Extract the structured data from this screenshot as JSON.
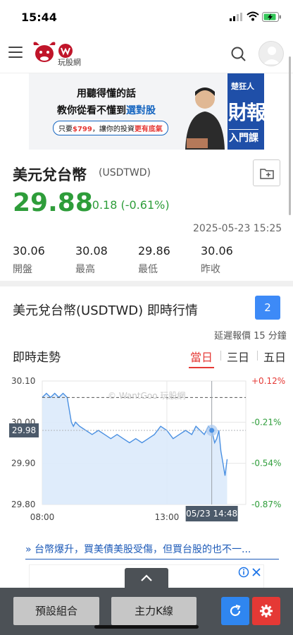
{
  "status": {
    "time": "15:44"
  },
  "nav": {
    "logo_text": "玩股網"
  },
  "banner": {
    "line1": "用聽得懂的話",
    "line2_pre": "教你從看不懂到",
    "line2_em": "選對股",
    "line3_pre": "只要",
    "line3_price": "$799",
    "line3_mid": "，讓你的投資",
    "line3_em": "更有底氣",
    "brand_name": "楚狂人",
    "brand_big": "財報",
    "brand_sub": "入門課"
  },
  "quote": {
    "name": "美元兌台幣",
    "code": "(USDTWD)",
    "price": "29.88",
    "change": "-0.18 (-0.61%)",
    "timestamp": "2025-05-23 15:25",
    "stats": [
      {
        "value": "30.06",
        "label": "開盤"
      },
      {
        "value": "30.08",
        "label": "最高"
      },
      {
        "value": "29.86",
        "label": "最低"
      },
      {
        "value": "30.06",
        "label": "昨收"
      }
    ]
  },
  "realtime": {
    "title": "美元兌台幣(USDTWD) 即時行情",
    "badge": "2",
    "delay_note": "延遲報價 15 分鐘",
    "trend_label": "即時走勢",
    "tabs": [
      "當日",
      "三日",
      "五日"
    ],
    "active_tab": "當日"
  },
  "chart_data": {
    "type": "line",
    "watermark": "© WantGoo 玩股網",
    "y_ticks": [
      "30.10",
      "30.00",
      "29.90",
      "29.80"
    ],
    "ylim": [
      29.8,
      30.1
    ],
    "right_ticks": [
      "+0.12%",
      "-0.21%",
      "-0.54%",
      "-0.87%"
    ],
    "x_ticks": [
      "08:00",
      "13:00"
    ],
    "reference_value": 30.06,
    "current_value_label": "29.98",
    "crosshair_time_label": "05/23 14:48",
    "colors": {
      "line": "#4a90e2",
      "fill": "#dceafb",
      "ref": "#555555",
      "up": "#e53935",
      "down": "#2e9d3a"
    },
    "series": [
      {
        "x": [
          "08:00",
          "08:10",
          "08:20",
          "08:30",
          "08:40",
          "08:50",
          "09:00",
          "09:10",
          "09:15",
          "09:20",
          "09:30",
          "09:45",
          "10:00",
          "10:15",
          "10:30",
          "10:45",
          "11:00",
          "11:15",
          "11:30",
          "11:45",
          "12:00",
          "12:15",
          "12:30",
          "12:45",
          "13:00",
          "13:15",
          "13:30",
          "13:45",
          "14:00",
          "14:10",
          "14:20",
          "14:30",
          "14:40",
          "14:48",
          "14:55",
          "15:00",
          "15:05",
          "15:10",
          "15:15",
          "15:20",
          "15:25"
        ],
        "values": [
          30.06,
          30.07,
          30.06,
          30.07,
          30.06,
          30.07,
          30.06,
          30.0,
          29.99,
          30.0,
          29.99,
          29.98,
          29.97,
          29.98,
          29.97,
          29.96,
          29.97,
          29.96,
          29.95,
          29.96,
          29.95,
          29.96,
          29.97,
          29.99,
          29.98,
          29.96,
          29.97,
          29.98,
          29.97,
          29.99,
          29.98,
          29.97,
          29.99,
          29.98,
          29.95,
          29.96,
          29.98,
          29.93,
          29.9,
          29.87,
          29.91
        ]
      }
    ]
  },
  "news": {
    "headline": "» 台幣爆升，買美債美股受傷，但買台股的也不一..."
  },
  "toolbar": {
    "preset_label": "預設組合",
    "kline_label": "主力K線"
  }
}
